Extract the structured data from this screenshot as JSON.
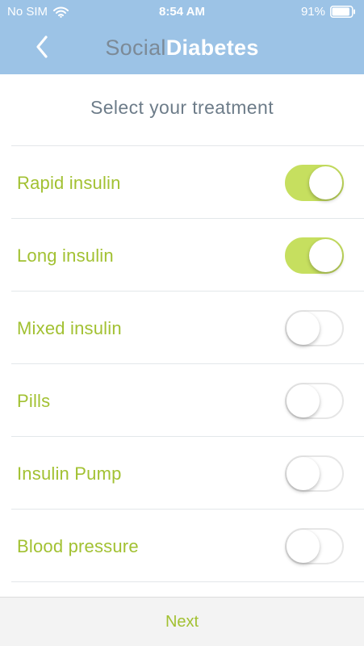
{
  "status_bar": {
    "carrier": "No SIM",
    "time": "8:54 AM",
    "battery_percent": "91%",
    "battery_level": 0.91,
    "wifi_icon": "wifi-icon",
    "battery_icon": "battery-icon"
  },
  "nav": {
    "back_icon": "chevron-left-icon",
    "logo_part1": "Social",
    "logo_part2": "Diabetes"
  },
  "title": "Select your treatment",
  "treatments": [
    {
      "label": "Rapid insulin",
      "enabled": true
    },
    {
      "label": "Long insulin",
      "enabled": true
    },
    {
      "label": "Mixed insulin",
      "enabled": false
    },
    {
      "label": "Pills",
      "enabled": false
    },
    {
      "label": "Insulin Pump",
      "enabled": false
    },
    {
      "label": "Blood pressure",
      "enabled": false
    }
  ],
  "footer": {
    "next_label": "Next"
  },
  "colors": {
    "header_background": "#9cc3e6",
    "accent_green": "#a2c132",
    "toggle_on": "#c6df5f",
    "title_gray": "#6d7c89",
    "logo_gray": "#7c8a97",
    "footer_background": "#f3f3f3"
  }
}
